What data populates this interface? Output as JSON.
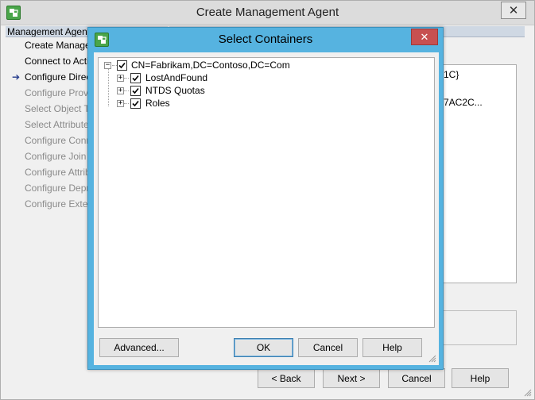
{
  "main_window": {
    "title": "Create Management Agent",
    "close_label": "✕",
    "nav_header": "Management Agent D",
    "nav_items": [
      {
        "label": "Create Managem",
        "state": "done"
      },
      {
        "label": "Connect to Activ",
        "state": "done"
      },
      {
        "label": "Configure Directo",
        "state": "current"
      },
      {
        "label": "Configure Provisi",
        "state": "disabled"
      },
      {
        "label": "Select Object Ty",
        "state": "disabled"
      },
      {
        "label": "Select Attributes",
        "state": "disabled"
      },
      {
        "label": "Configure Conne",
        "state": "disabled"
      },
      {
        "label": "Configure Join ar",
        "state": "disabled"
      },
      {
        "label": "Configure Attribut",
        "state": "disabled"
      },
      {
        "label": "Configure Deprov",
        "state": "disabled"
      },
      {
        "label": "Configure Extens",
        "state": "disabled"
      }
    ],
    "content_fragments": [
      "1C}",
      "7AC2C..."
    ],
    "buttons": {
      "back": "< Back",
      "next": "Next >",
      "cancel": "Cancel",
      "help": "Help"
    }
  },
  "dialog": {
    "title": "Select Containers",
    "close_label": "✕",
    "tree": {
      "root": {
        "label": "CN=Fabrikam,DC=Contoso,DC=Com",
        "checked": true,
        "expander": "−"
      },
      "children": [
        {
          "label": "LostAndFound",
          "checked": true,
          "expander": "+"
        },
        {
          "label": "NTDS Quotas",
          "checked": true,
          "expander": "+"
        },
        {
          "label": "Roles",
          "checked": true,
          "expander": "+"
        }
      ]
    },
    "buttons": {
      "advanced": "Advanced...",
      "ok": "OK",
      "cancel": "Cancel",
      "help": "Help"
    }
  },
  "colors": {
    "dialog_frame": "#56b3e0",
    "dialog_close": "#c75050",
    "disabled_text": "#8a8a8a",
    "current_arrow": "#243b8c"
  },
  "icons": [
    "app-icon",
    "close-icon",
    "current-step-arrow-icon",
    "checkbox-checked-icon",
    "tree-expander-icon",
    "resize-grip-icon"
  ]
}
